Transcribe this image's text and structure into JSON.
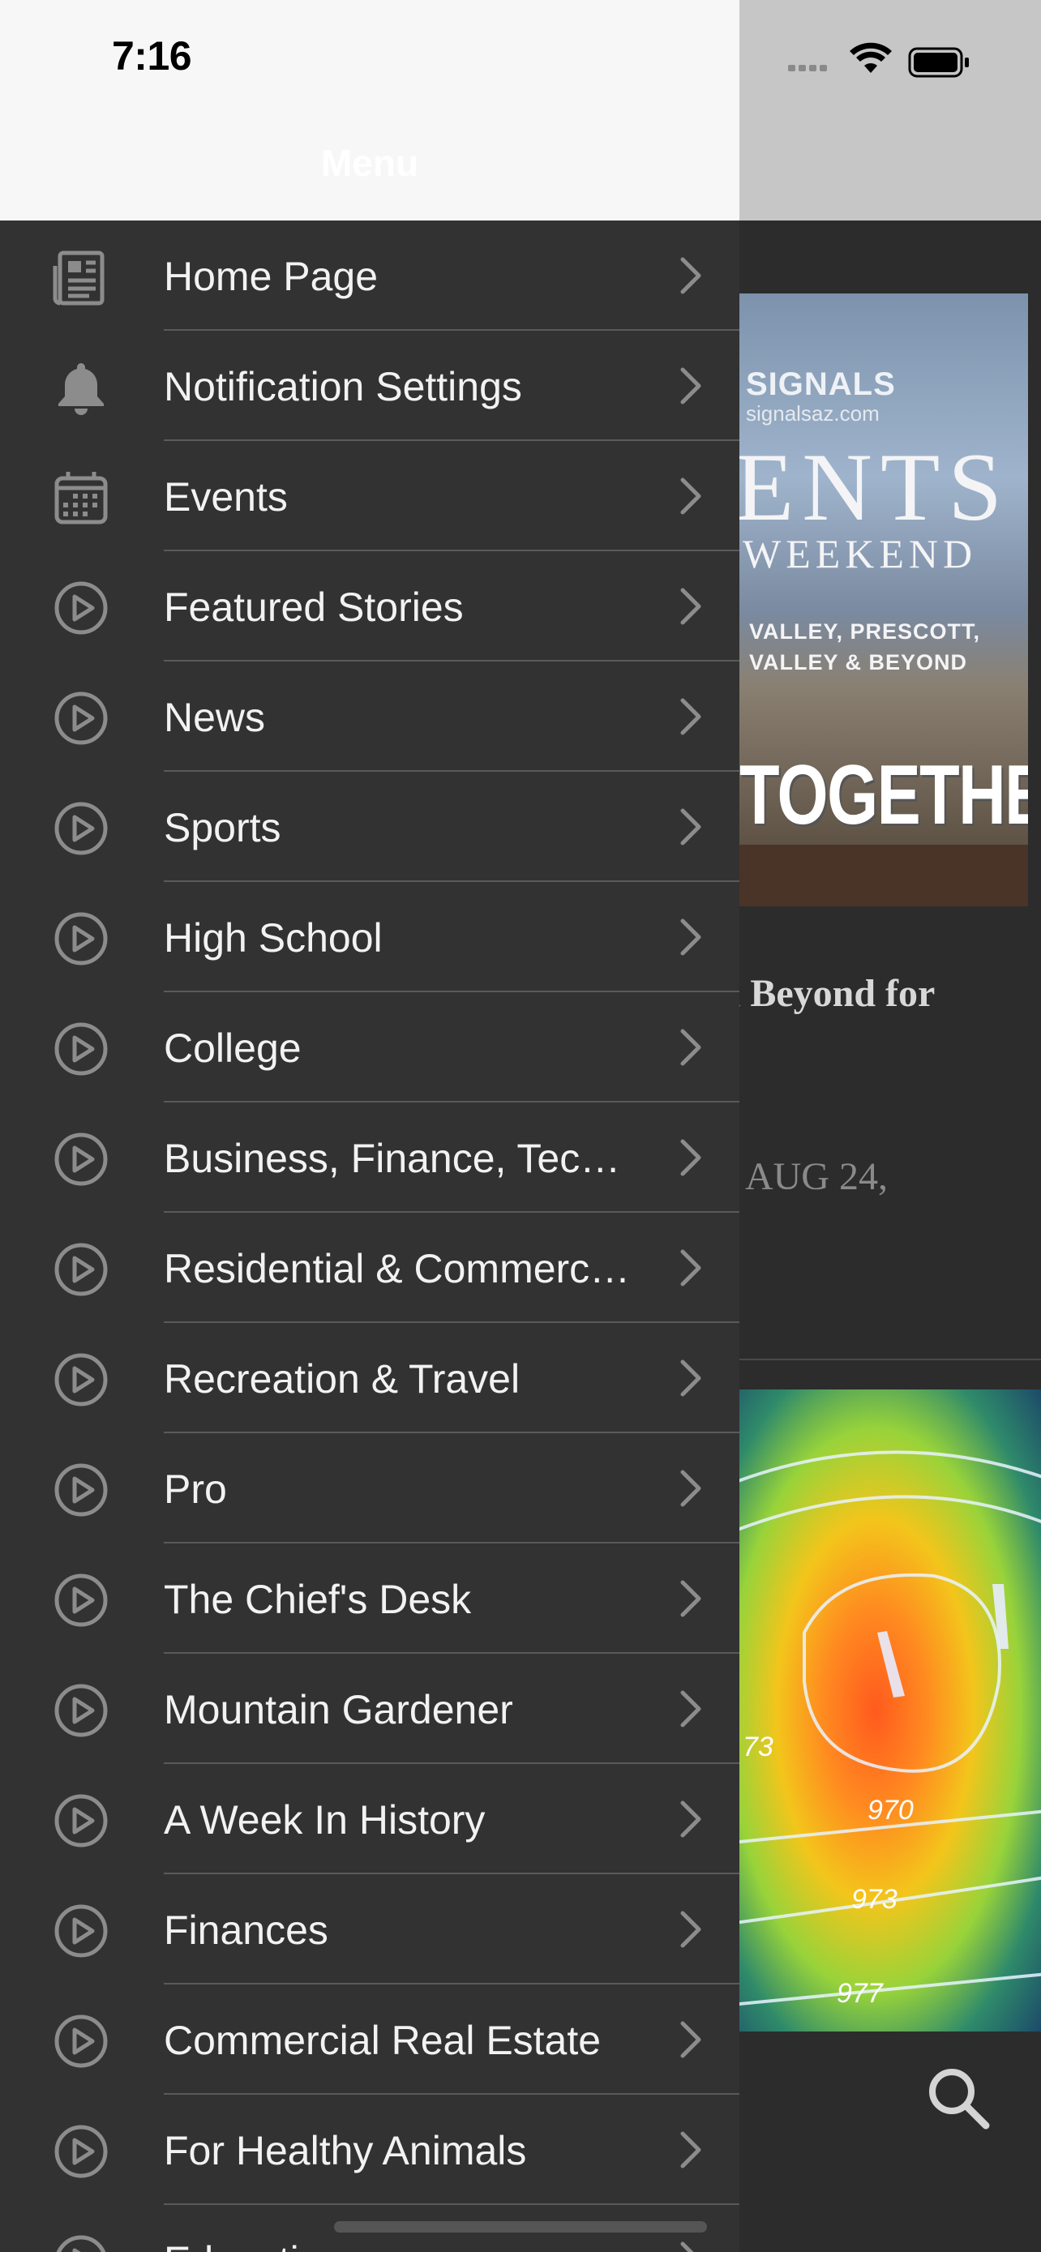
{
  "status_bar": {
    "time": "7:16"
  },
  "header": {
    "title": "Menu"
  },
  "menu_items": [
    {
      "label": "Home Page",
      "icon": "newspaper-icon"
    },
    {
      "label": "Notification Settings",
      "icon": "bell-icon"
    },
    {
      "label": "Events",
      "icon": "calendar-icon"
    },
    {
      "label": "Featured Stories",
      "icon": "play-circle-icon"
    },
    {
      "label": "News",
      "icon": "play-circle-icon"
    },
    {
      "label": "Sports",
      "icon": "play-circle-icon"
    },
    {
      "label": "High School",
      "icon": "play-circle-icon"
    },
    {
      "label": "College",
      "icon": "play-circle-icon"
    },
    {
      "label": "Business, Finance, Tec…",
      "icon": "play-circle-icon"
    },
    {
      "label": "Residential & Commerc…",
      "icon": "play-circle-icon"
    },
    {
      "label": "Recreation & Travel",
      "icon": "play-circle-icon"
    },
    {
      "label": "Pro",
      "icon": "play-circle-icon"
    },
    {
      "label": "The Chief's Desk",
      "icon": "play-circle-icon"
    },
    {
      "label": "Mountain Gardener",
      "icon": "play-circle-icon"
    },
    {
      "label": "A Week In History",
      "icon": "play-circle-icon"
    },
    {
      "label": "Finances",
      "icon": "play-circle-icon"
    },
    {
      "label": "Commercial Real Estate",
      "icon": "play-circle-icon"
    },
    {
      "label": "For Healthy Animals",
      "icon": "play-circle-icon"
    },
    {
      "label": "Educati…",
      "icon": "play-circle-icon"
    }
  ],
  "background": {
    "ad": {
      "brand": "SIGNALS",
      "domain": "signalsaz.com",
      "big": "ENTS",
      "mid": "WEEKEND",
      "loc1": "VALLEY, PRESCOTT,",
      "loc2": "VALLEY & BEYOND",
      "slogan": "TOGETHER!"
    },
    "headline_fragment": "l Beyond for",
    "date_fragment": "| AUG 24,",
    "weather_labels": [
      "73",
      "970",
      "973",
      "977"
    ]
  },
  "colors": {
    "drawer_bg": "#323232",
    "header_bg": "#f7f7f7",
    "text": "#f2f2f2",
    "icon": "#8c8c8c",
    "separator": "#5a5a5a"
  }
}
